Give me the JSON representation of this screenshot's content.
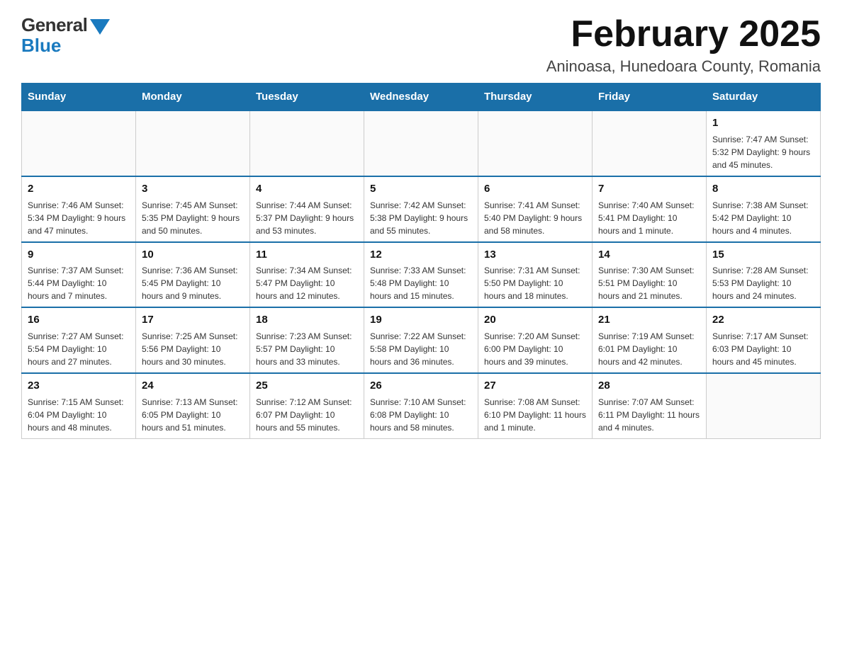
{
  "logo": {
    "general": "General",
    "blue": "Blue"
  },
  "title": "February 2025",
  "subtitle": "Aninoasa, Hunedoara County, Romania",
  "days_of_week": [
    "Sunday",
    "Monday",
    "Tuesday",
    "Wednesday",
    "Thursday",
    "Friday",
    "Saturday"
  ],
  "weeks": [
    [
      {
        "day": "",
        "info": ""
      },
      {
        "day": "",
        "info": ""
      },
      {
        "day": "",
        "info": ""
      },
      {
        "day": "",
        "info": ""
      },
      {
        "day": "",
        "info": ""
      },
      {
        "day": "",
        "info": ""
      },
      {
        "day": "1",
        "info": "Sunrise: 7:47 AM\nSunset: 5:32 PM\nDaylight: 9 hours\nand 45 minutes."
      }
    ],
    [
      {
        "day": "2",
        "info": "Sunrise: 7:46 AM\nSunset: 5:34 PM\nDaylight: 9 hours\nand 47 minutes."
      },
      {
        "day": "3",
        "info": "Sunrise: 7:45 AM\nSunset: 5:35 PM\nDaylight: 9 hours\nand 50 minutes."
      },
      {
        "day": "4",
        "info": "Sunrise: 7:44 AM\nSunset: 5:37 PM\nDaylight: 9 hours\nand 53 minutes."
      },
      {
        "day": "5",
        "info": "Sunrise: 7:42 AM\nSunset: 5:38 PM\nDaylight: 9 hours\nand 55 minutes."
      },
      {
        "day": "6",
        "info": "Sunrise: 7:41 AM\nSunset: 5:40 PM\nDaylight: 9 hours\nand 58 minutes."
      },
      {
        "day": "7",
        "info": "Sunrise: 7:40 AM\nSunset: 5:41 PM\nDaylight: 10 hours\nand 1 minute."
      },
      {
        "day": "8",
        "info": "Sunrise: 7:38 AM\nSunset: 5:42 PM\nDaylight: 10 hours\nand 4 minutes."
      }
    ],
    [
      {
        "day": "9",
        "info": "Sunrise: 7:37 AM\nSunset: 5:44 PM\nDaylight: 10 hours\nand 7 minutes."
      },
      {
        "day": "10",
        "info": "Sunrise: 7:36 AM\nSunset: 5:45 PM\nDaylight: 10 hours\nand 9 minutes."
      },
      {
        "day": "11",
        "info": "Sunrise: 7:34 AM\nSunset: 5:47 PM\nDaylight: 10 hours\nand 12 minutes."
      },
      {
        "day": "12",
        "info": "Sunrise: 7:33 AM\nSunset: 5:48 PM\nDaylight: 10 hours\nand 15 minutes."
      },
      {
        "day": "13",
        "info": "Sunrise: 7:31 AM\nSunset: 5:50 PM\nDaylight: 10 hours\nand 18 minutes."
      },
      {
        "day": "14",
        "info": "Sunrise: 7:30 AM\nSunset: 5:51 PM\nDaylight: 10 hours\nand 21 minutes."
      },
      {
        "day": "15",
        "info": "Sunrise: 7:28 AM\nSunset: 5:53 PM\nDaylight: 10 hours\nand 24 minutes."
      }
    ],
    [
      {
        "day": "16",
        "info": "Sunrise: 7:27 AM\nSunset: 5:54 PM\nDaylight: 10 hours\nand 27 minutes."
      },
      {
        "day": "17",
        "info": "Sunrise: 7:25 AM\nSunset: 5:56 PM\nDaylight: 10 hours\nand 30 minutes."
      },
      {
        "day": "18",
        "info": "Sunrise: 7:23 AM\nSunset: 5:57 PM\nDaylight: 10 hours\nand 33 minutes."
      },
      {
        "day": "19",
        "info": "Sunrise: 7:22 AM\nSunset: 5:58 PM\nDaylight: 10 hours\nand 36 minutes."
      },
      {
        "day": "20",
        "info": "Sunrise: 7:20 AM\nSunset: 6:00 PM\nDaylight: 10 hours\nand 39 minutes."
      },
      {
        "day": "21",
        "info": "Sunrise: 7:19 AM\nSunset: 6:01 PM\nDaylight: 10 hours\nand 42 minutes."
      },
      {
        "day": "22",
        "info": "Sunrise: 7:17 AM\nSunset: 6:03 PM\nDaylight: 10 hours\nand 45 minutes."
      }
    ],
    [
      {
        "day": "23",
        "info": "Sunrise: 7:15 AM\nSunset: 6:04 PM\nDaylight: 10 hours\nand 48 minutes."
      },
      {
        "day": "24",
        "info": "Sunrise: 7:13 AM\nSunset: 6:05 PM\nDaylight: 10 hours\nand 51 minutes."
      },
      {
        "day": "25",
        "info": "Sunrise: 7:12 AM\nSunset: 6:07 PM\nDaylight: 10 hours\nand 55 minutes."
      },
      {
        "day": "26",
        "info": "Sunrise: 7:10 AM\nSunset: 6:08 PM\nDaylight: 10 hours\nand 58 minutes."
      },
      {
        "day": "27",
        "info": "Sunrise: 7:08 AM\nSunset: 6:10 PM\nDaylight: 11 hours\nand 1 minute."
      },
      {
        "day": "28",
        "info": "Sunrise: 7:07 AM\nSunset: 6:11 PM\nDaylight: 11 hours\nand 4 minutes."
      },
      {
        "day": "",
        "info": ""
      }
    ]
  ]
}
